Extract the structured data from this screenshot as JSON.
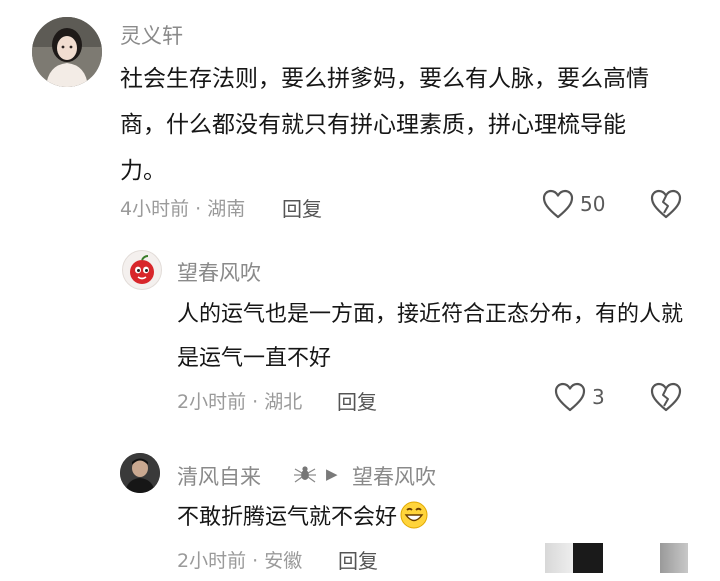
{
  "comments": [
    {
      "username": "灵义轩",
      "text": "社会生存法则，要么拼爹妈，要么有人脉，要么高情商，什么都没有就只有拼心理素质，拼心理梳导能力。",
      "meta": "4小时前 · 湖南",
      "reply_label": "回复",
      "likes": "50"
    },
    {
      "username": "望春风吹",
      "text": "人的运气也是一方面，接近符合正态分布，有的人就是运气一直不好",
      "meta": "2小时前 · 湖北",
      "reply_label": "回复",
      "likes": "3"
    },
    {
      "username": "清风自来",
      "reply_to": "望春风吹",
      "text": "不敢折腾运气就不会好",
      "meta": "2小时前 · 安徽",
      "reply_label": "回复"
    }
  ],
  "icons": {
    "like": "heart-outline-icon",
    "dislike": "broken-heart-icon",
    "reply_arrow": "right-triangle-icon",
    "badge": "spider-badge-icon",
    "emoji": "grinning-emoji-icon"
  }
}
